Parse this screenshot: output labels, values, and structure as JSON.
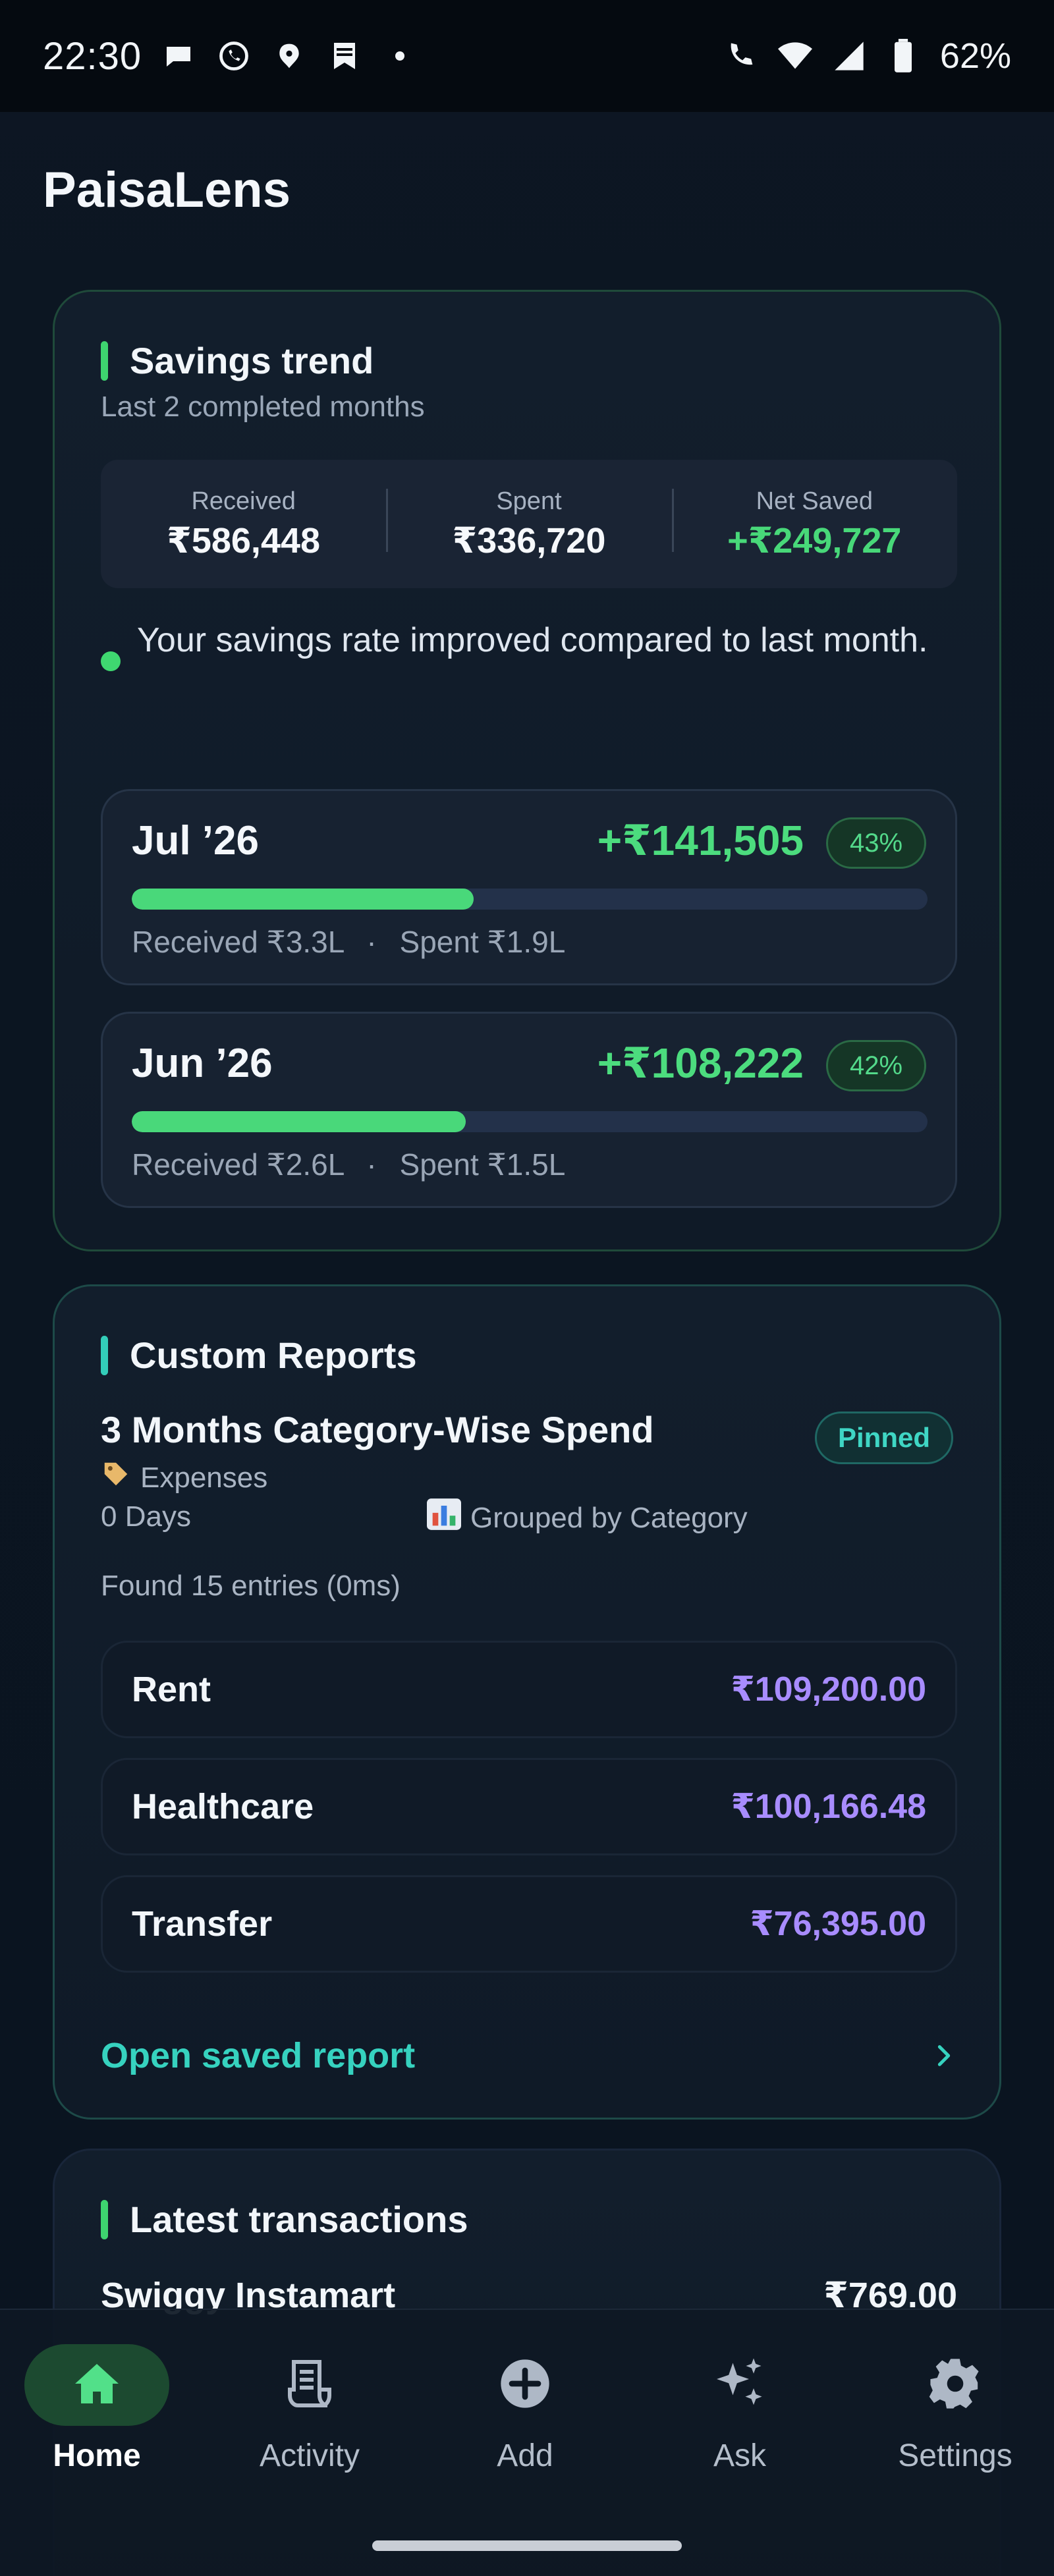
{
  "status_bar": {
    "time": "22:30",
    "battery": "62%"
  },
  "app": {
    "title": "PaisaLens"
  },
  "savings_trend": {
    "title": "Savings trend",
    "subtitle": "Last 2 completed months",
    "stats": {
      "received_label": "Received",
      "received_value": "₹586,448",
      "spent_label": "Spent",
      "spent_value": "₹336,720",
      "net_label": "Net Saved",
      "net_value": "+₹249,727"
    },
    "insight": "Your savings rate improved compared to last month.",
    "months": [
      {
        "name": "Jul ’26",
        "saved": "+₹141,505",
        "pct_label": "43%",
        "pct": 43,
        "received": "Received ₹3.3L",
        "spent": "Spent ₹1.9L"
      },
      {
        "name": "Jun ’26",
        "saved": "+₹108,222",
        "pct_label": "42%",
        "pct": 42,
        "received": "Received ₹2.6L",
        "spent": "Spent ₹1.5L"
      }
    ],
    "separator": "·"
  },
  "custom_reports": {
    "title": "Custom Reports",
    "report_name": "3 Months Category-Wise Spend",
    "pinned_label": "Pinned",
    "type_label": "Expenses",
    "days_label": "0 Days",
    "group_label": "Grouped by Category",
    "found_text": "Found 15 entries (0ms)",
    "entries": [
      {
        "name": "Rent",
        "amount": "₹109,200.00"
      },
      {
        "name": "Healthcare",
        "amount": "₹100,166.48"
      },
      {
        "name": "Transfer",
        "amount": "₹76,395.00"
      }
    ],
    "open_label": "Open saved report"
  },
  "latest_transactions": {
    "title": "Latest transactions",
    "items": [
      {
        "name": "Swiggy Instamart",
        "amount": "₹769.00"
      }
    ]
  },
  "bottom_nav": {
    "items": [
      {
        "label": "Home",
        "icon": "home-icon",
        "active": true
      },
      {
        "label": "Activity",
        "icon": "receipt-icon",
        "active": false
      },
      {
        "label": "Add",
        "icon": "add-circle-icon",
        "active": false
      },
      {
        "label": "Ask",
        "icon": "sparkle-icon",
        "active": false
      },
      {
        "label": "Settings",
        "icon": "gear-icon",
        "active": false
      }
    ]
  },
  "colors": {
    "positive": "#4cdc7e",
    "amount_purple": "#a88cff",
    "teal": "#36d2bf",
    "background": "#0c1521"
  }
}
